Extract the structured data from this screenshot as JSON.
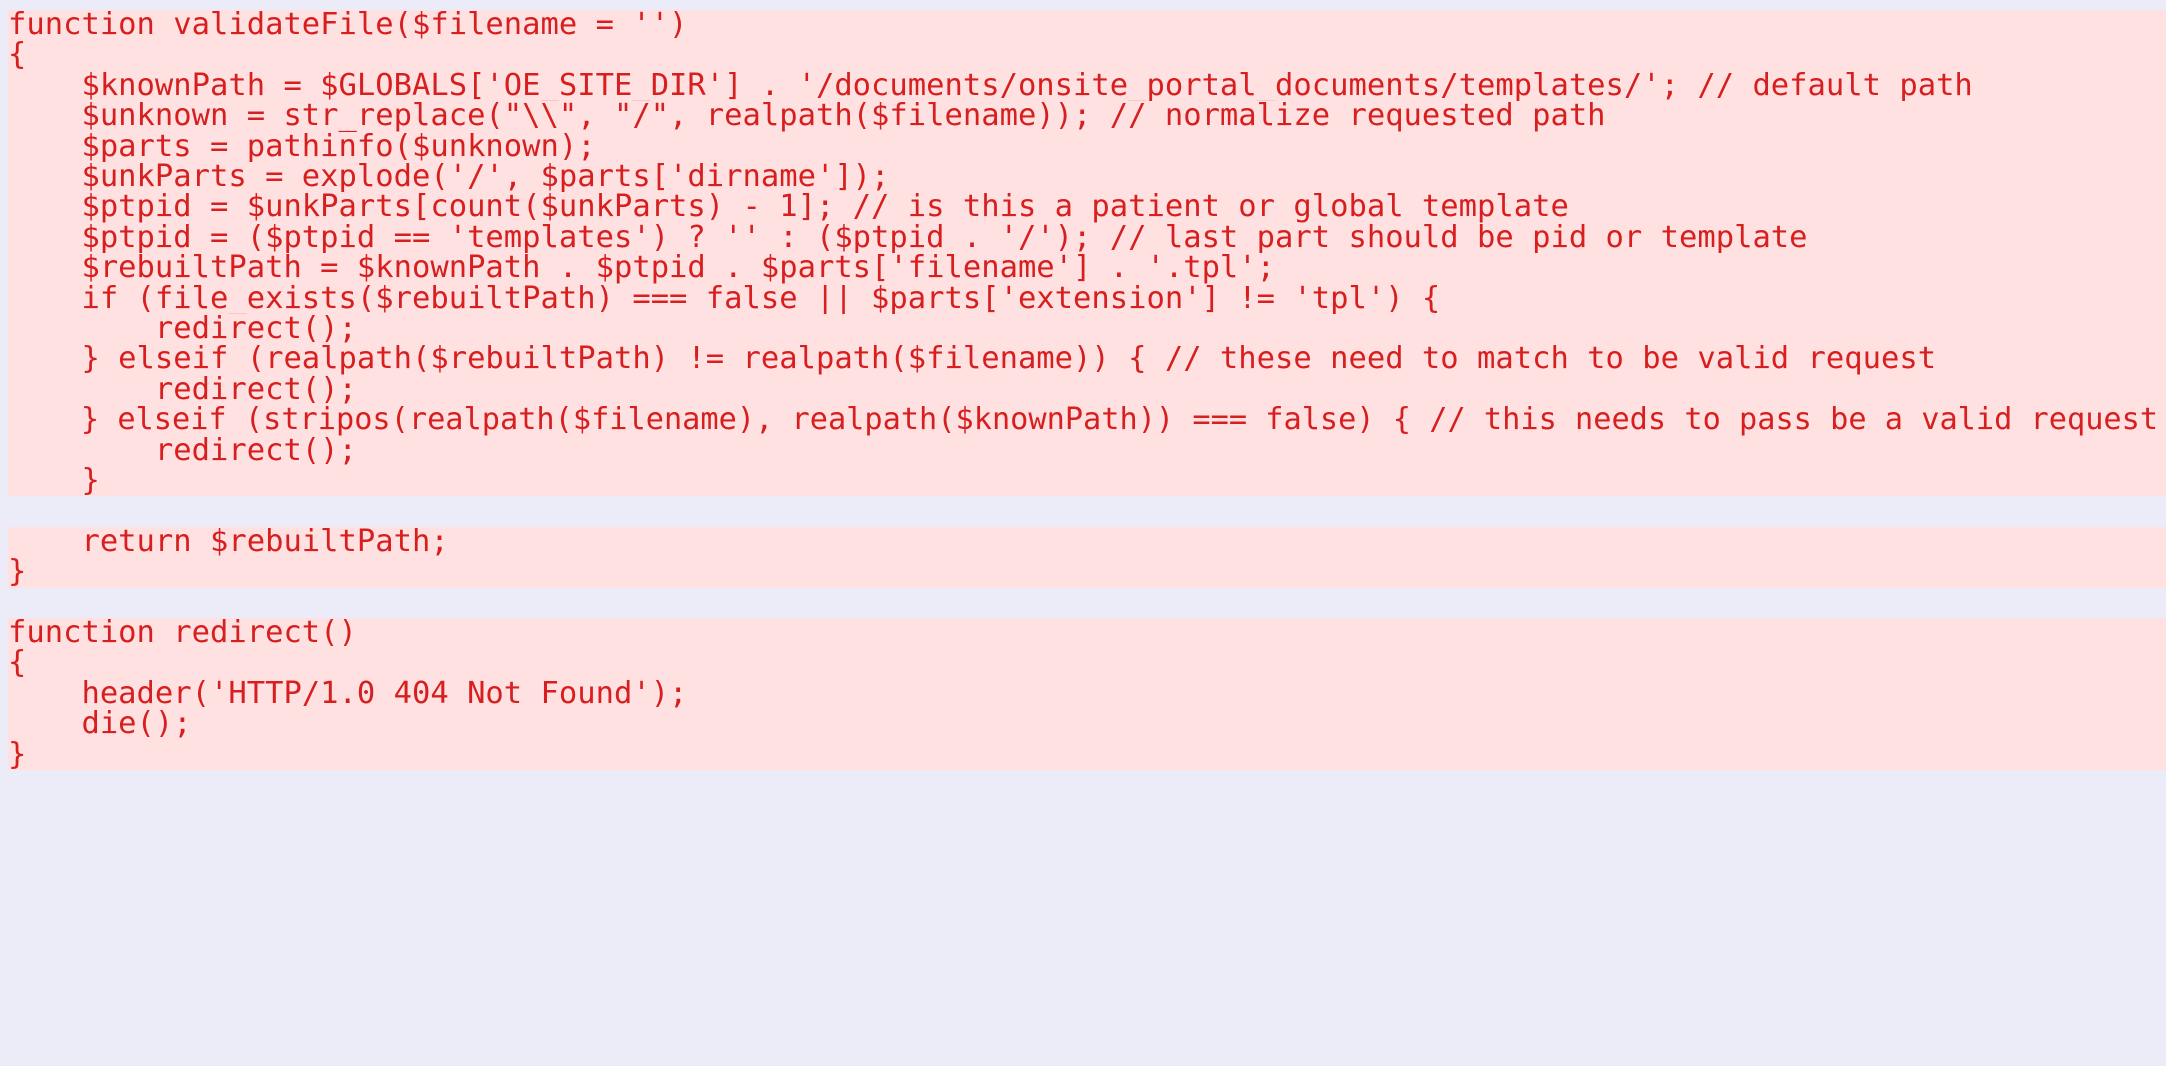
{
  "diff": {
    "removed_background": "#ffe1e1",
    "context_background": "#ececf8",
    "text_color": "#d81f1f",
    "lines": [
      {
        "text": "function validateFile($filename = '')",
        "type": "removed"
      },
      {
        "text": "{",
        "type": "removed"
      },
      {
        "text": "    $knownPath = $GLOBALS['OE_SITE_DIR'] . '/documents/onsite_portal_documents/templates/'; // default path",
        "type": "removed"
      },
      {
        "text": "    $unknown = str_replace(\"\\\\\", \"/\", realpath($filename)); // normalize requested path",
        "type": "removed"
      },
      {
        "text": "    $parts = pathinfo($unknown);",
        "type": "removed"
      },
      {
        "text": "    $unkParts = explode('/', $parts['dirname']);",
        "type": "removed"
      },
      {
        "text": "    $ptpid = $unkParts[count($unkParts) - 1]; // is this a patient or global template",
        "type": "removed"
      },
      {
        "text": "    $ptpid = ($ptpid == 'templates') ? '' : ($ptpid . '/'); // last part should be pid or template",
        "type": "removed"
      },
      {
        "text": "    $rebuiltPath = $knownPath . $ptpid . $parts['filename'] . '.tpl';",
        "type": "removed"
      },
      {
        "text": "    if (file_exists($rebuiltPath) === false || $parts['extension'] != 'tpl') {",
        "type": "removed"
      },
      {
        "text": "        redirect();",
        "type": "removed"
      },
      {
        "text": "    } elseif (realpath($rebuiltPath) != realpath($filename)) { // these need to match to be valid request",
        "type": "removed"
      },
      {
        "text": "        redirect();",
        "type": "removed"
      },
      {
        "text": "    } elseif (stripos(realpath($filename), realpath($knownPath)) === false) { // this needs to pass be a valid request",
        "type": "removed"
      },
      {
        "text": "        redirect();",
        "type": "removed"
      },
      {
        "text": "    }",
        "type": "removed"
      },
      {
        "text": "",
        "type": "context"
      },
      {
        "text": "    return $rebuiltPath;",
        "type": "removed"
      },
      {
        "text": "}",
        "type": "removed"
      },
      {
        "text": "",
        "type": "context"
      },
      {
        "text": "function redirect()",
        "type": "removed"
      },
      {
        "text": "{",
        "type": "removed"
      },
      {
        "text": "    header('HTTP/1.0 404 Not Found');",
        "type": "removed"
      },
      {
        "text": "    die();",
        "type": "removed"
      },
      {
        "text": "}",
        "type": "removed"
      }
    ]
  }
}
